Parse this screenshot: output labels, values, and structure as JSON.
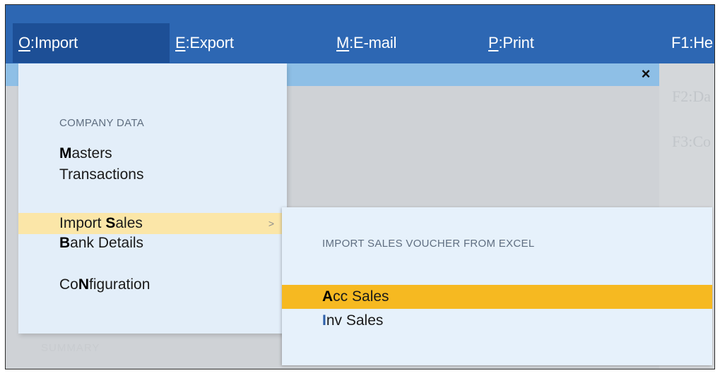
{
  "menubar": {
    "items": [
      {
        "key": "O",
        "label": ":Import"
      },
      {
        "key": "E",
        "label": ":Export"
      },
      {
        "key": "M",
        "label": ":E-mail"
      },
      {
        "key": "P",
        "label": ":Print"
      },
      {
        "key": "F1",
        "label": ":He"
      }
    ]
  },
  "background": {
    "ghost_f2": "F2:Da",
    "ghost_f3": "F3:Co",
    "summary": "SUMMARY"
  },
  "import_menu": {
    "section_company": "COMPANY DATA",
    "masters": {
      "key": "M",
      "rest": "asters"
    },
    "transactions": {
      "key": "T",
      "rest": "ransactions"
    },
    "import_sales": {
      "pre": "Import ",
      "key": "S",
      "rest": "ales",
      "arrow": ">"
    },
    "bank_details": {
      "key": "B",
      "rest": "ank Details"
    },
    "configuration": {
      "pre": "Co",
      "key": "N",
      "rest": "figuration"
    }
  },
  "submenu": {
    "heading": "IMPORT SALES VOUCHER FROM EXCEL",
    "acc_sales": {
      "key": "A",
      "rest": "cc Sales"
    },
    "inv_sales": {
      "key": "I",
      "rest": "nv Sales"
    }
  },
  "colors": {
    "menubar": "#2d67b3",
    "menu_bg": "#e3eef9",
    "hover_highlight": "#fbe6a8",
    "selected_highlight": "#f6b921"
  }
}
